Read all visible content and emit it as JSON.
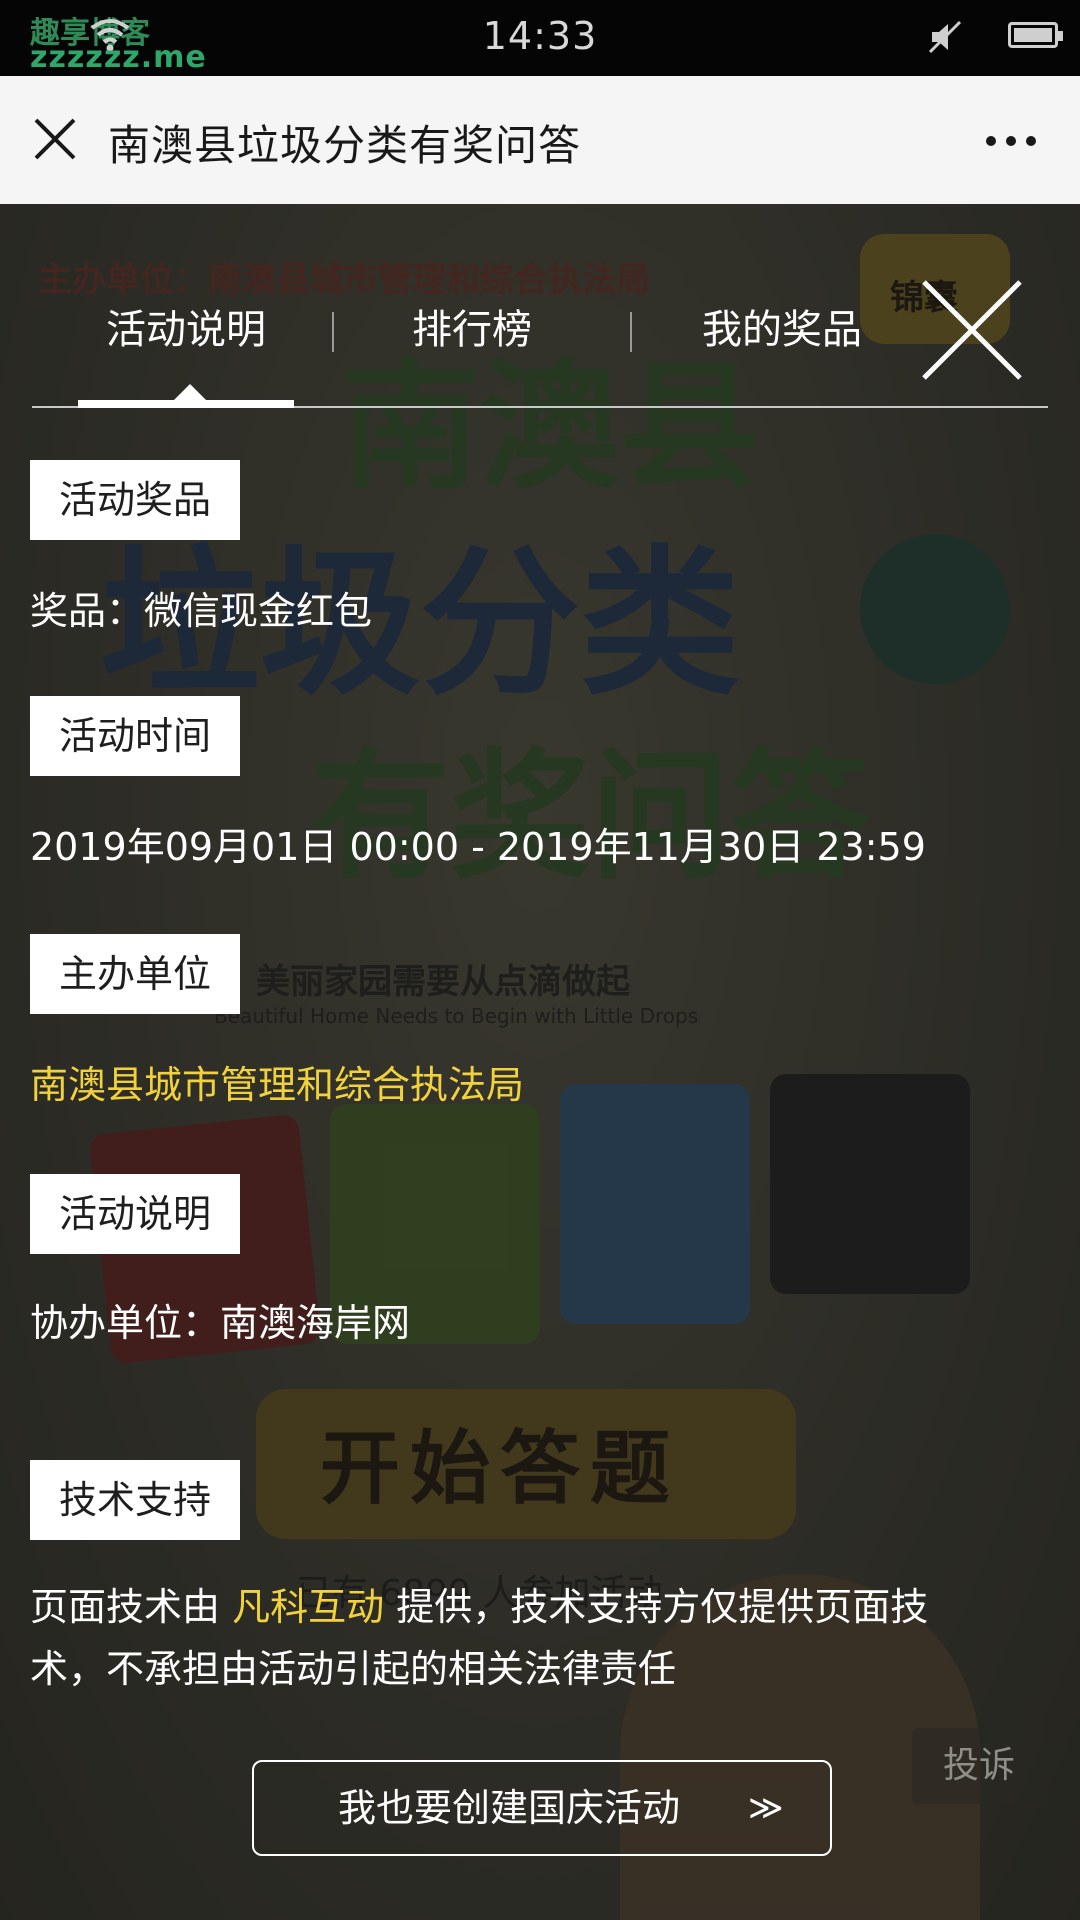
{
  "status_bar": {
    "time": "14:33",
    "watermark_top": "趣享博客",
    "watermark_bottom": "zzzzzz.me"
  },
  "title_bar": {
    "title": "南澳县垃圾分类有奖问答",
    "close_icon": "close-icon",
    "more_icon": "more-icon"
  },
  "poster": {
    "organizer_line": "主办单位：南澳县城市管理和综合执法局",
    "big_title_1": "南澳县",
    "big_title_2": "垃圾分类",
    "big_title_3": "有奖问答",
    "slogan_cn": "美丽家园需要从点滴做起",
    "slogan_en": "Beautiful Home Needs to Begin with Little Drops",
    "start_button": "开始答题",
    "participants": "已有 6899 人参加活动",
    "badge": "锦囊",
    "complain": "投诉"
  },
  "tabs": [
    {
      "label": "活动说明",
      "active": true
    },
    {
      "label": "排行榜",
      "active": false
    },
    {
      "label": "我的奖品",
      "active": false
    }
  ],
  "sections": {
    "prize": {
      "label": "活动奖品",
      "text": "奖品：微信现金红包"
    },
    "time": {
      "label": "活动时间",
      "text": "2019年09月01日 00:00 - 2019年11月30日 23:59"
    },
    "organizer": {
      "label": "主办单位",
      "text": "南澳县城市管理和综合执法局"
    },
    "description": {
      "label": "活动说明",
      "text": "协办单位：南澳海岸网"
    },
    "tech": {
      "label": "技术支持",
      "text_pre": "页面技术由 ",
      "text_link": "凡科互动",
      "text_post_1": " 提供，技术支持方仅提供页面技",
      "text_post_2": "术，不承担由活动引起的相关法律责任"
    }
  },
  "create_button": {
    "label": "我也要创建国庆活动",
    "arrows": "≫"
  },
  "colors": {
    "highlight": "#f1d23a",
    "overlay": "rgba(10,10,10,0.42)"
  }
}
